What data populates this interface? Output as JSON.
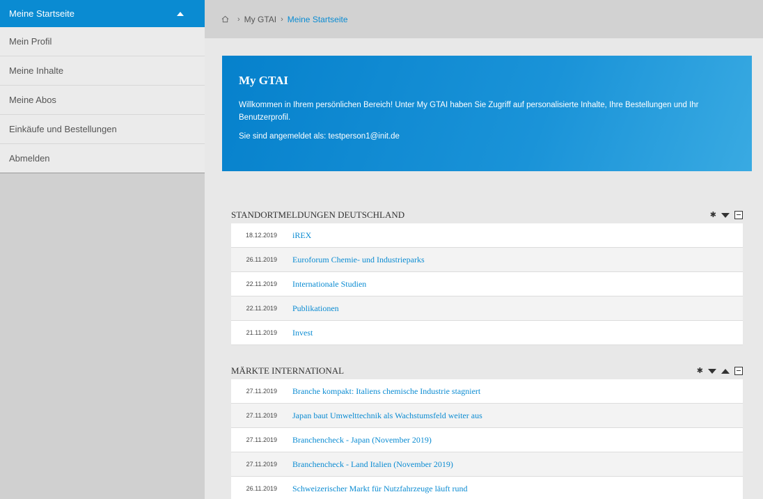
{
  "sidebar": {
    "active_label": "Meine Startseite",
    "items": [
      {
        "label": "Mein Profil"
      },
      {
        "label": "Meine Inhalte"
      },
      {
        "label": "Meine Abos"
      },
      {
        "label": "Einkäufe und Bestellungen"
      },
      {
        "label": "Abmelden"
      }
    ]
  },
  "breadcrumb": {
    "items": [
      "My GTAI",
      "Meine Startseite"
    ]
  },
  "hero": {
    "title": "My GTAI",
    "welcome": "Willkommen in Ihrem persönlichen Bereich! Unter My GTAI haben Sie Zugriff auf personalisierte Inhalte, Ihre Bestellungen und Ihr Benutzerprofil.",
    "logged_in": "Sie sind angemeldet als: testperson1@init.de"
  },
  "sections": [
    {
      "title": "STANDORTMELDUNGEN DEUTSCHLAND",
      "rows": [
        {
          "date": "18.12.2019",
          "title": "iREX"
        },
        {
          "date": "26.11.2019",
          "title": "Euroforum Chemie- und Industrieparks"
        },
        {
          "date": "22.11.2019",
          "title": "Internationale Studien"
        },
        {
          "date": "22.11.2019",
          "title": "Publikationen"
        },
        {
          "date": "21.11.2019",
          "title": "Invest"
        }
      ]
    },
    {
      "title": "MÄRKTE INTERNATIONAL",
      "rows": [
        {
          "date": "27.11.2019",
          "title": "Branche kompakt: Italiens chemische Industrie stagniert"
        },
        {
          "date": "27.11.2019",
          "title": "Japan baut Umwelttechnik als Wachstumsfeld weiter aus"
        },
        {
          "date": "27.11.2019",
          "title": "Branchencheck - Japan (November 2019)"
        },
        {
          "date": "27.11.2019",
          "title": "Branchencheck - Land Italien (November 2019)"
        },
        {
          "date": "26.11.2019",
          "title": "Schweizerischer Markt für Nutzfahrzeuge läuft rund"
        }
      ]
    }
  ]
}
